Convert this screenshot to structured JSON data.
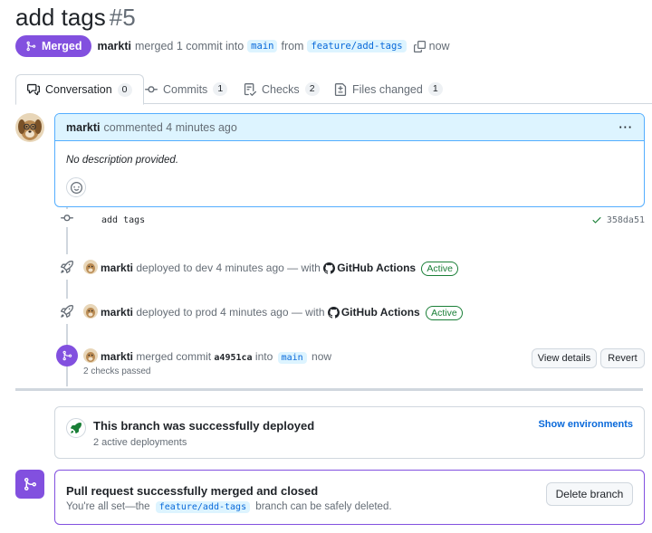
{
  "header": {
    "title": "add tags",
    "number": "#5",
    "status": "Merged",
    "author": "markti",
    "summary": "merged 1 commit into",
    "base_branch": "main",
    "from_text": "from",
    "head_branch": "feature/add-tags",
    "time": "now"
  },
  "tabs": [
    {
      "label": "Conversation",
      "count": "0",
      "icon": "comment-discussion-icon"
    },
    {
      "label": "Commits",
      "count": "1",
      "icon": "git-commit-icon"
    },
    {
      "label": "Checks",
      "count": "2",
      "icon": "checklist-icon"
    },
    {
      "label": "Files changed",
      "count": "1",
      "icon": "file-diff-icon"
    }
  ],
  "comment": {
    "author": "markti",
    "action": "commented 4 minutes ago",
    "body": "No description provided.",
    "menu": "···"
  },
  "timeline": {
    "commit": {
      "message": "add tags",
      "sha": "358da51"
    },
    "deploy_dev": {
      "author": "markti",
      "text": "deployed to dev 4 minutes ago — with",
      "app": "GitHub Actions",
      "state": "Active"
    },
    "deploy_prod": {
      "author": "markti",
      "text": "deployed to prod 4 minutes ago — with",
      "app": "GitHub Actions",
      "state": "Active"
    },
    "merge": {
      "author": "markti",
      "text": "merged commit",
      "sha": "a4951ca",
      "into": "into",
      "branch": "main",
      "time": "now",
      "checks": "2 checks passed",
      "view_details": "View details",
      "revert": "Revert"
    }
  },
  "deploy_box": {
    "title": "This branch was successfully deployed",
    "subtitle": "2 active deployments",
    "action": "Show environments"
  },
  "merged_box": {
    "title": "Pull request successfully merged and closed",
    "sub_before": "You're all set—the",
    "branch": "feature/add-tags",
    "sub_after": "branch can be safely deleted.",
    "delete_button": "Delete branch"
  },
  "colors": {
    "merged": "#8250df",
    "link": "#0969da",
    "success": "#1a7f37",
    "comment_header": "#ddf4ff"
  }
}
